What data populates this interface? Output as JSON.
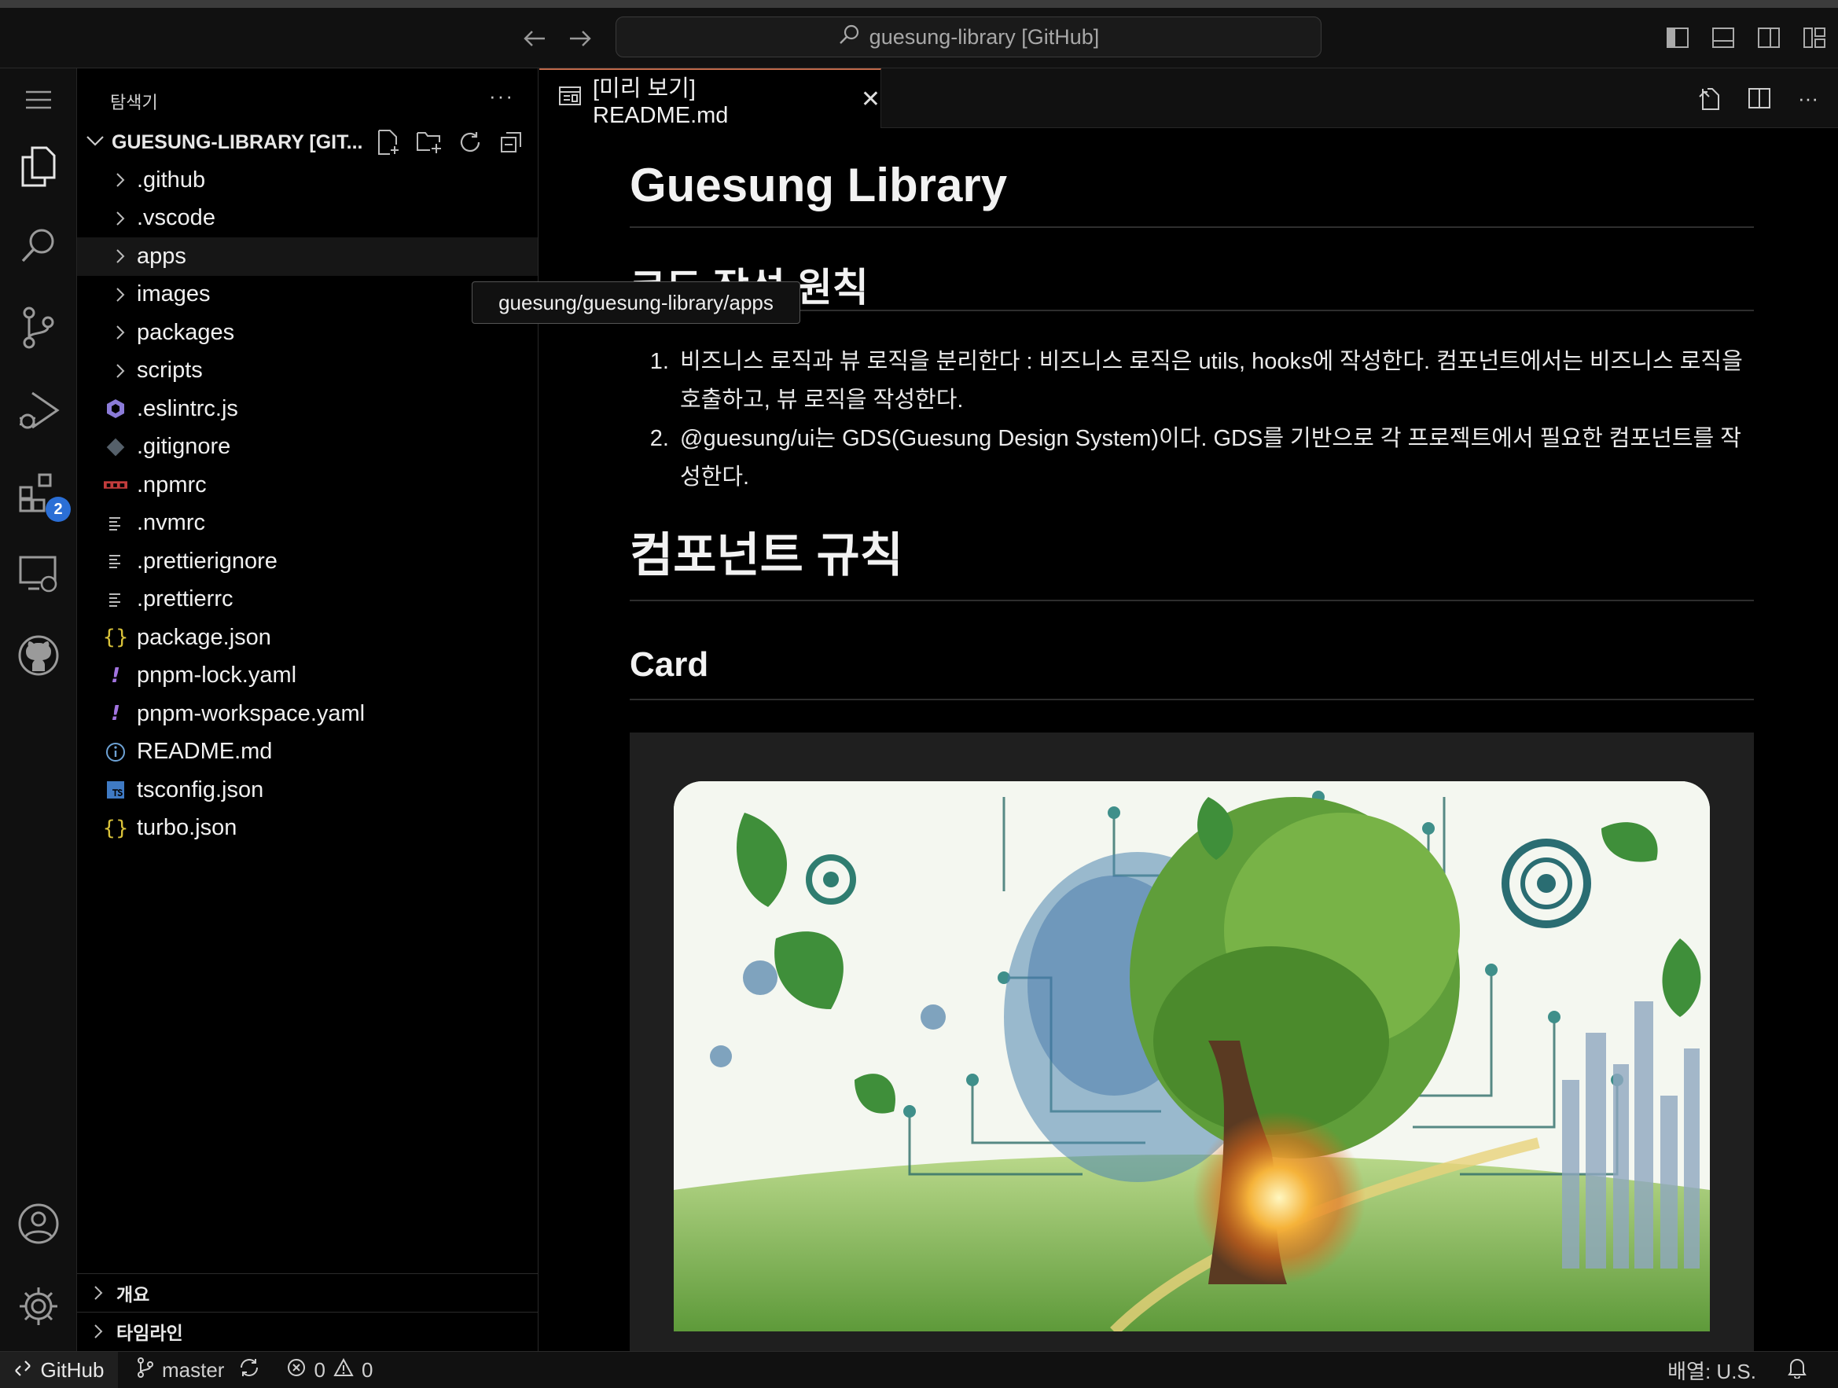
{
  "titlebar": {
    "command_center": "guesung-library [GitHub]"
  },
  "activity_bar": {
    "extensions_badge": "2"
  },
  "sidebar": {
    "title": "탐색기",
    "more": "···",
    "root_label": "GUESUNG-LIBRARY [GIT...",
    "items": [
      {
        "label": ".github",
        "type": "folder"
      },
      {
        "label": ".vscode",
        "type": "folder"
      },
      {
        "label": "apps",
        "type": "folder"
      },
      {
        "label": "images",
        "type": "folder"
      },
      {
        "label": "packages",
        "type": "folder"
      },
      {
        "label": "scripts",
        "type": "folder"
      },
      {
        "label": ".eslintrc.js",
        "type": "eslint"
      },
      {
        "label": ".gitignore",
        "type": "git"
      },
      {
        "label": ".npmrc",
        "type": "npm"
      },
      {
        "label": ".nvmrc",
        "type": "text"
      },
      {
        "label": ".prettierignore",
        "type": "text"
      },
      {
        "label": ".prettierrc",
        "type": "text"
      },
      {
        "label": "package.json",
        "type": "json"
      },
      {
        "label": "pnpm-lock.yaml",
        "type": "yaml"
      },
      {
        "label": "pnpm-workspace.yaml",
        "type": "yaml"
      },
      {
        "label": "README.md",
        "type": "info"
      },
      {
        "label": "tsconfig.json",
        "type": "ts"
      },
      {
        "label": "turbo.json",
        "type": "json"
      }
    ],
    "outline_label": "개요",
    "timeline_label": "타임라인",
    "tooltip": "guesung/guesung-library/apps"
  },
  "editor": {
    "tab_label": "[미리 보기] README.md",
    "tab_close": "✕",
    "tab_more": "···",
    "h1_title": "Guesung Library",
    "h2_partial": "코드 작성 원칙",
    "rules": [
      "비즈니스 로직과 뷰 로직을 분리한다 : 비즈니스 로직은 utils, hooks에 작성한다. 컴포넌트에서는 비즈니스 로직을 호출하고, 뷰 로직을 작성한다.",
      "@guesung/ui는 GDS(Guesung Design System)이다. GDS를 기반으로 각 프로젝트에서 필요한 컴포넌트를 작성한다."
    ],
    "h1_components": "컴포넌트 규칙",
    "h2_card": "Card"
  },
  "statusbar": {
    "remote": "GitHub",
    "branch": "master",
    "errors": "0",
    "warnings": "0",
    "layout": "배열: U.S."
  },
  "colors": {
    "accent_tab": "#c0694a",
    "badge": "#2b6fd6",
    "json_icon": "#d9c23a",
    "yaml_icon": "#a274e0",
    "eslint_icon": "#8b7bd8",
    "npm_icon": "#c33c3c",
    "ts_icon": "#3f7ac4"
  }
}
